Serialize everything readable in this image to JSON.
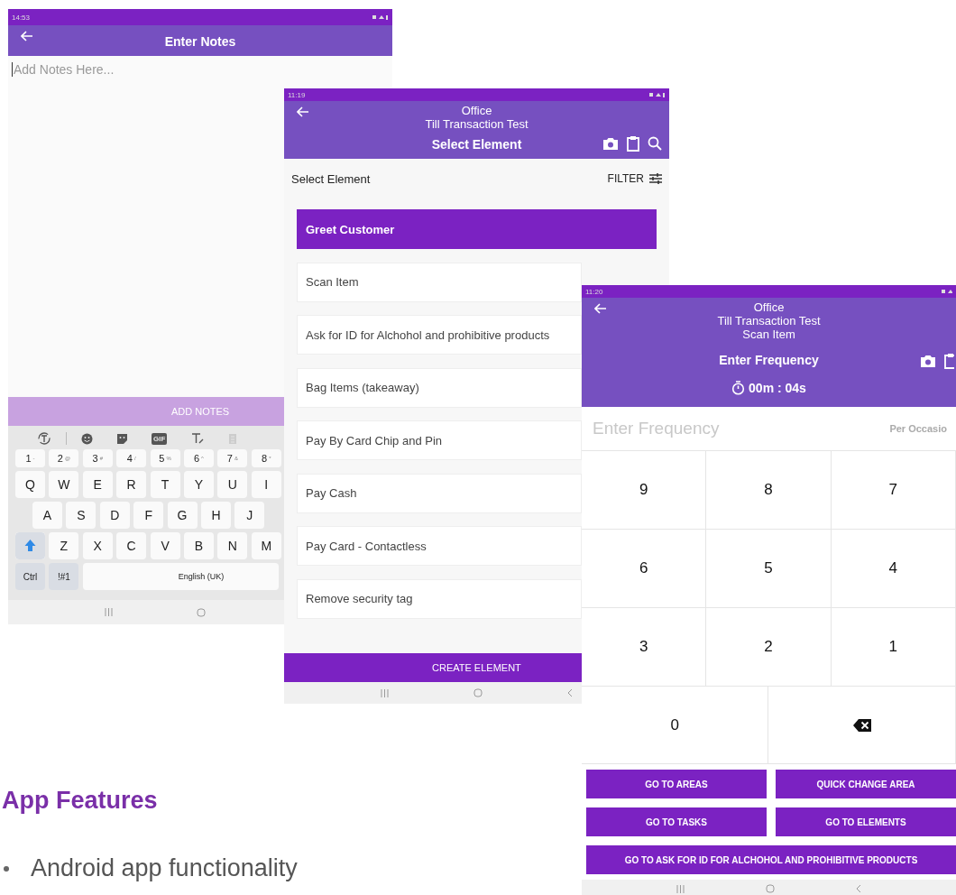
{
  "notes_screen": {
    "status_time": "14:53",
    "title": "Enter Notes",
    "placeholder": "Add Notes Here...",
    "button": "ADD NOTES",
    "keyboard": {
      "gif": "GIF",
      "number_row": [
        {
          "key": "1",
          "alt": "-"
        },
        {
          "key": "2",
          "alt": "@"
        },
        {
          "key": "3",
          "alt": "#"
        },
        {
          "key": "4",
          "alt": "/"
        },
        {
          "key": "5",
          "alt": "%"
        },
        {
          "key": "6",
          "alt": "^"
        },
        {
          "key": "7",
          "alt": "&"
        },
        {
          "key": "8",
          "alt": "*"
        }
      ],
      "rows": [
        [
          {
            "kind": "char",
            "label": "Q"
          },
          {
            "kind": "char",
            "label": "W"
          },
          {
            "kind": "char",
            "label": "E"
          },
          {
            "kind": "char",
            "label": "R"
          },
          {
            "kind": "char",
            "label": "T"
          },
          {
            "kind": "char",
            "label": "Y"
          },
          {
            "kind": "char",
            "label": "U"
          },
          {
            "kind": "char",
            "label": "I"
          }
        ],
        [
          {
            "kind": "char",
            "label": "A"
          },
          {
            "kind": "char",
            "label": "S"
          },
          {
            "kind": "char",
            "label": "D"
          },
          {
            "kind": "char",
            "label": "F"
          },
          {
            "kind": "char",
            "label": "G"
          },
          {
            "kind": "char",
            "label": "H"
          },
          {
            "kind": "char",
            "label": "J"
          }
        ],
        [
          {
            "kind": "shift"
          },
          {
            "kind": "char",
            "label": "Z"
          },
          {
            "kind": "char",
            "label": "X"
          },
          {
            "kind": "char",
            "label": "C"
          },
          {
            "kind": "char",
            "label": "V"
          },
          {
            "kind": "char",
            "label": "B"
          },
          {
            "kind": "char",
            "label": "N"
          },
          {
            "kind": "char",
            "label": "M"
          }
        ]
      ],
      "ctrl": "Ctrl",
      "symbols": "!#1",
      "space": "English (UK)"
    }
  },
  "element_screen": {
    "status_time": "11:19",
    "subtitles": [
      "Office",
      "Till Transaction Test"
    ],
    "title": "Select Element",
    "list_heading": "Select Element",
    "filter": "FILTER",
    "items": [
      {
        "label": "Greet Customer",
        "selected": true
      },
      {
        "label": "Scan Item",
        "selected": false
      },
      {
        "label": "Ask for ID for Alchohol and prohibitive products",
        "selected": false
      },
      {
        "label": "Bag Items (takeaway)",
        "selected": false
      },
      {
        "label": "Pay By Card Chip and Pin",
        "selected": false
      },
      {
        "label": "Pay Cash",
        "selected": false
      },
      {
        "label": "Pay Card - Contactless",
        "selected": false
      },
      {
        "label": "Remove security tag",
        "selected": false
      }
    ],
    "button": "CREATE ELEMENT"
  },
  "frequency_screen": {
    "status_time": "11:20",
    "subtitles": [
      "Office",
      "Till Transaction Test",
      "Scan Item"
    ],
    "title": "Enter Frequency",
    "timer": "00m : 04s",
    "placeholder": "Enter Frequency",
    "unit": "Per Occasio",
    "keys": [
      "9",
      "8",
      "7",
      "6",
      "5",
      "4",
      "3",
      "2",
      "1",
      "0"
    ],
    "buttons": [
      "GO TO AREAS",
      "QUICK CHANGE AREA",
      "GO TO TASKS",
      "GO TO ELEMENTS",
      "GO TO ASK FOR ID FOR ALCHOHOL AND PROHIBITIVE PRODUCTS"
    ]
  },
  "slide": {
    "heading": "App Features",
    "bullets": [
      "Android app functionality"
    ]
  }
}
